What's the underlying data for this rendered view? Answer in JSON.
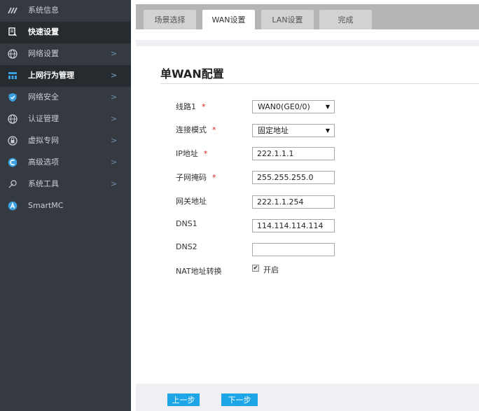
{
  "sidebar": {
    "items": [
      {
        "label": "系统信息",
        "icon": "dashboard-icon",
        "active": false,
        "has_arrow": false
      },
      {
        "label": "快速设置",
        "icon": "quick-setup-icon",
        "active": true,
        "has_arrow": false
      },
      {
        "label": "网络设置",
        "icon": "globe-icon",
        "active": false,
        "has_arrow": true
      },
      {
        "label": "上网行为管理",
        "icon": "behavior-icon",
        "active": true,
        "has_arrow": true
      },
      {
        "label": "网络安全",
        "icon": "shield-icon",
        "active": false,
        "has_arrow": true
      },
      {
        "label": "认证管理",
        "icon": "globe-icon",
        "active": false,
        "has_arrow": true
      },
      {
        "label": "虚拟专网",
        "icon": "vpn-icon",
        "active": false,
        "has_arrow": true
      },
      {
        "label": "高级选项",
        "icon": "advanced-icon",
        "active": false,
        "has_arrow": true
      },
      {
        "label": "系统工具",
        "icon": "tools-icon",
        "active": false,
        "has_arrow": true
      },
      {
        "label": "SmartMC",
        "icon": "smartmc-icon",
        "active": false,
        "has_arrow": false
      }
    ],
    "arrow_glyph": ">"
  },
  "tabs": [
    {
      "label": "场景选择",
      "active": false
    },
    {
      "label": "WAN设置",
      "active": true
    },
    {
      "label": "LAN设置",
      "active": false
    },
    {
      "label": "完成",
      "active": false
    }
  ],
  "page": {
    "title": "单WAN配置"
  },
  "form": {
    "required_mark": "*",
    "line_label": "线路1",
    "line_value": "WAN0(GE0/0)",
    "mode_label": "连接模式",
    "mode_value": "固定地址",
    "ip_label": "IP地址",
    "ip_value": "222.1.1.1",
    "mask_label": "子网掩码",
    "mask_value": "255.255.255.0",
    "gateway_label": "网关地址",
    "gateway_value": "222.1.1.254",
    "dns1_label": "DNS1",
    "dns1_value": "114.114.114.114",
    "dns2_label": "DNS2",
    "dns2_value": "",
    "nat_label": "NAT地址转换",
    "nat_enabled": true,
    "nat_option_label": "开启",
    "caret_glyph": "▼",
    "check_glyph": "✔"
  },
  "buttons": {
    "prev_label": "上一步",
    "next_label": "下一步"
  },
  "colors": {
    "sidebar_bg": "#343a40",
    "sidebar_active_bg": "#262b30",
    "accent": "#1ea5e8",
    "required": "#e02020",
    "arrow": "#6f8db0"
  }
}
